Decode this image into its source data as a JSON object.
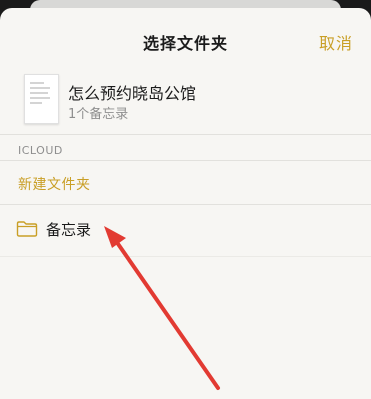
{
  "nav": {
    "title": "选择文件夹",
    "cancel_label": "取消"
  },
  "note": {
    "title": "怎么预约晓岛公馆",
    "count": "1个备忘录"
  },
  "section": {
    "label": "ICLOUD"
  },
  "actions": {
    "new_folder_label": "新建文件夹"
  },
  "folders": [
    {
      "label": "备忘录",
      "icon": "folder-icon"
    }
  ],
  "colors": {
    "accent": "#c99f26",
    "annotation_arrow": "#e23a32"
  }
}
